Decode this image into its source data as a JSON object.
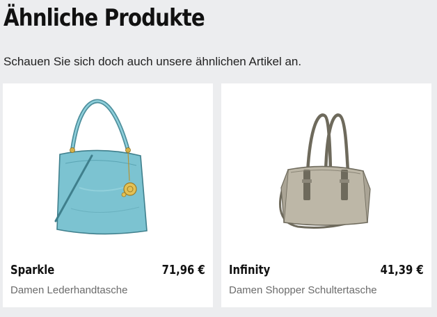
{
  "section": {
    "title": "Ähnliche Produkte",
    "subtitle": "Schauen Sie sich doch auch unsere ähnlichen Artikel an."
  },
  "products": [
    {
      "name": "Sparkle",
      "price": "71,96 €",
      "description": "Damen Lederhandtasche",
      "image_alt": "Damen Lederhandtasche",
      "color": "#7fc4d2"
    },
    {
      "name": "Infinity",
      "price": "41,39 €",
      "description": "Damen Shopper Schultertasche",
      "image_alt": "Damen Shopper Schultertasche",
      "color": "#b8b2a2"
    }
  ]
}
